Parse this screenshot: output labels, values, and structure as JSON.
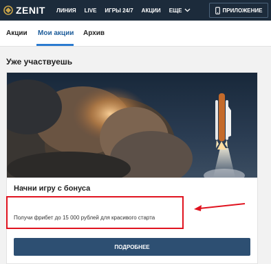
{
  "brand": {
    "logo_text": "ZENIT"
  },
  "nav": {
    "items": [
      "ЛИНИЯ",
      "LIVE",
      "ИГРЫ 24/7",
      "АКЦИИ"
    ],
    "more_label": "ЕЩЕ",
    "app_label": "ПРИЛОЖЕНИЕ"
  },
  "tabs": [
    {
      "label": "Акции",
      "active": false
    },
    {
      "label": "Мои акции",
      "active": true
    },
    {
      "label": "Архив",
      "active": false
    }
  ],
  "section": {
    "title": "Уже участвуешь"
  },
  "promo": {
    "title": "Начни игру с бонуса",
    "description": "Получи фрибет до 15 000 рублей для красивого старта",
    "cta_label": "ПОДРОБНЕЕ"
  },
  "colors": {
    "navbar": "#1c2b3b",
    "accent": "#2b7bd0",
    "button": "#2d4f72",
    "highlight": "#e0121e"
  }
}
